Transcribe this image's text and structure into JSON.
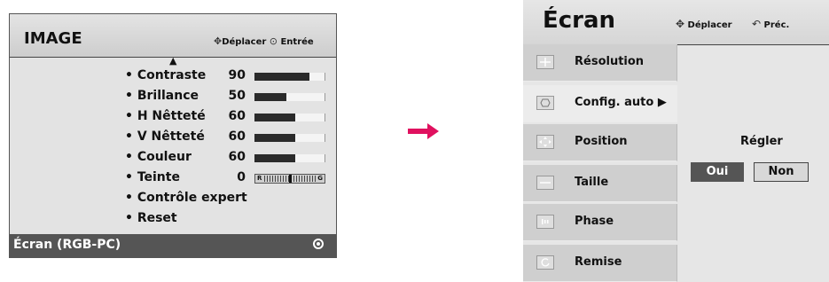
{
  "left": {
    "title": "IMAGE",
    "hint_move_icon": "move-icon",
    "hint_move": "Déplacer",
    "hint_enter_icon": "enter-icon",
    "hint_enter": "Entrée",
    "scroll_up_icon": "triangle-up-icon",
    "items": [
      {
        "label": "• Contraste",
        "value": "90",
        "level": 0.78
      },
      {
        "label": "• Brillance",
        "value": "50",
        "level": 0.45
      },
      {
        "label": "• H Nêtteté",
        "value": "60",
        "level": 0.58
      },
      {
        "label": "• V Nêtteté",
        "value": "60",
        "level": 0.58
      },
      {
        "label": "• Couleur",
        "value": "60",
        "level": 0.58
      },
      {
        "label": "• Teinte",
        "value": "0",
        "tint_left": "R",
        "tint_right": "G"
      },
      {
        "label": "• Contrôle expert"
      },
      {
        "label": "• Reset"
      }
    ],
    "footer_label": "Écran (RGB-PC)"
  },
  "right": {
    "title": "Écran",
    "hint_move": "Déplacer",
    "hint_back": "Préc.",
    "items": [
      {
        "label": "Résolution",
        "icon": "resolution-icon"
      },
      {
        "label": "Config. auto ▶",
        "icon": "auto-config-icon"
      },
      {
        "label": "Position",
        "icon": "position-icon"
      },
      {
        "label": "Taille",
        "icon": "size-icon"
      },
      {
        "label": "Phase",
        "icon": "phase-icon"
      },
      {
        "label": "Remise",
        "icon": "reset-icon"
      }
    ],
    "dialog_title": "Régler",
    "yes": "Oui",
    "no": "Non"
  },
  "colors": {
    "arrow": "#e0115f",
    "selected": "#555555"
  }
}
